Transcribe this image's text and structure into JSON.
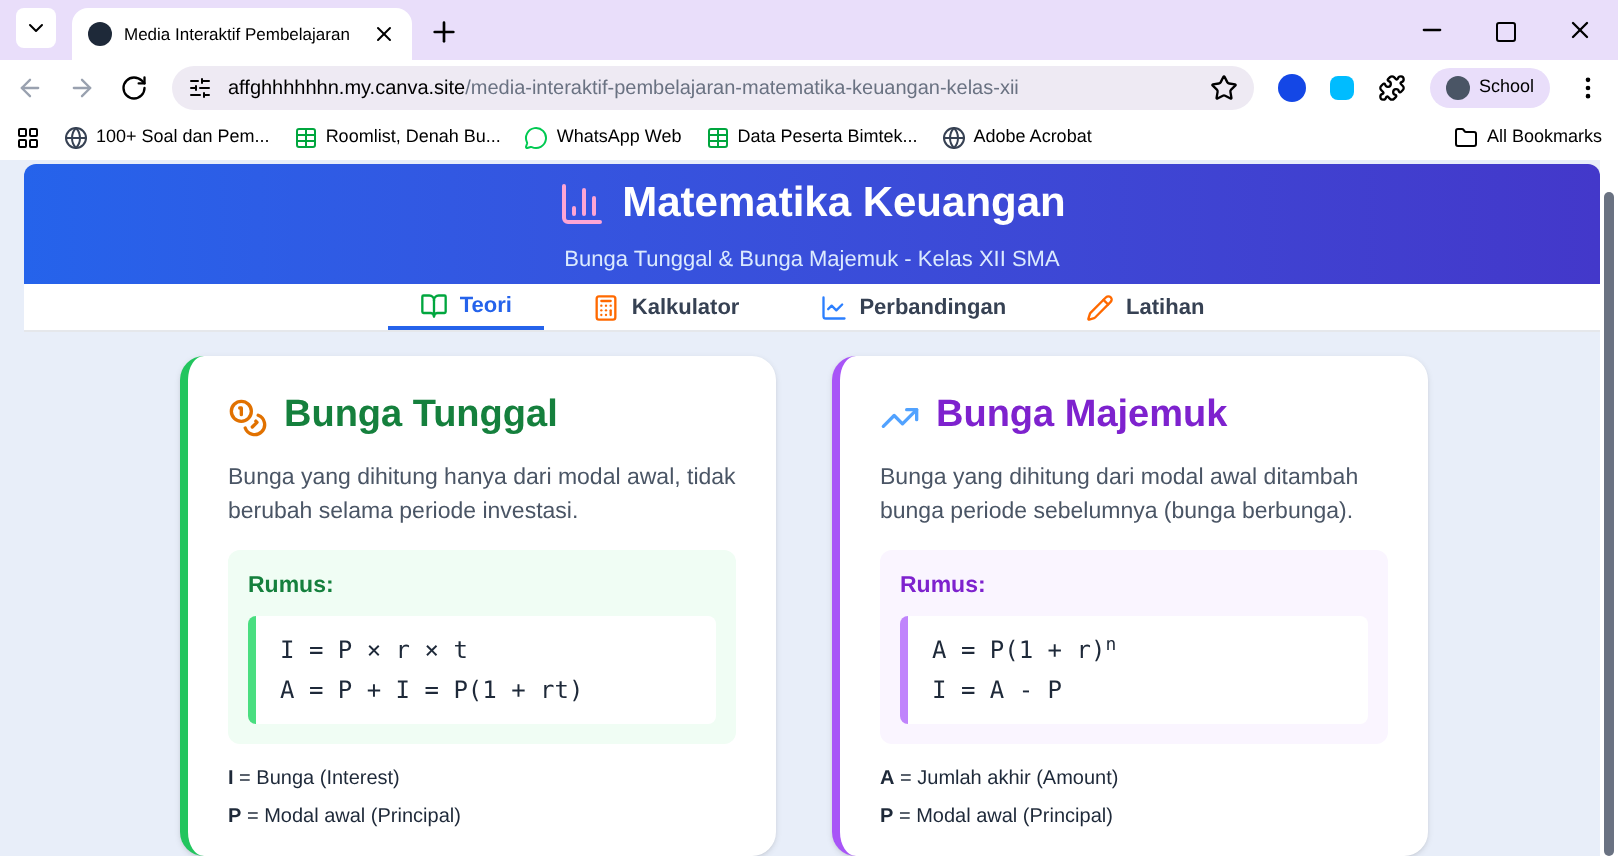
{
  "browser": {
    "tab_title": "Media Interaktif Pembelajaran",
    "url_domain": "affghhhhhhn.my.canva.site",
    "url_path": "/media-interaktif-pembelajaran-matematika-keuangan-kelas-xii",
    "profile": "School",
    "bookmarks": [
      {
        "label": "100+ Soal dan Pem...",
        "kind": "globe"
      },
      {
        "label": "Roomlist, Denah Bu...",
        "kind": "sheet"
      },
      {
        "label": "WhatsApp Web",
        "kind": "chat"
      },
      {
        "label": "Data Peserta Bimtek...",
        "kind": "sheet"
      },
      {
        "label": "Adobe Acrobat",
        "kind": "globe"
      }
    ],
    "all_bookmarks": "All Bookmarks"
  },
  "header": {
    "title": "Matematika Keuangan",
    "subtitle": "Bunga Tunggal & Bunga Majemuk - Kelas XII SMA"
  },
  "tabs": [
    {
      "label": "Teori",
      "kind": "books",
      "selected": true
    },
    {
      "label": "Kalkulator",
      "kind": "calculator",
      "selected": false
    },
    {
      "label": "Perbandingan",
      "kind": "chart",
      "selected": false
    },
    {
      "label": "Latihan",
      "kind": "pencil",
      "selected": false
    }
  ],
  "cards": [
    {
      "kind": "simple",
      "title": "Bunga Tunggal",
      "description": "Bunga yang dihitung hanya dari modal awal, tidak berubah selama periode investasi.",
      "formula_label": "Rumus:",
      "formulas": [
        "I = P × r × t",
        "A = P + I = P(1 + rt)"
      ],
      "definitions": [
        "**I** = Bunga (Interest)",
        "**P** = Modal awal (Principal)"
      ]
    },
    {
      "kind": "compound",
      "title": "Bunga Majemuk",
      "description": "Bunga yang dihitung dari modal awal ditambah bunga periode sebelumnya (bunga berbunga).",
      "formula_label": "Rumus:",
      "formulas": [
        "A = P(1 + r)$^{n}$",
        "I = A - P"
      ],
      "definitions": [
        "**A** = Jumlah akhir (Amount)",
        "**P** = Modal awal (Principal)"
      ]
    }
  ]
}
